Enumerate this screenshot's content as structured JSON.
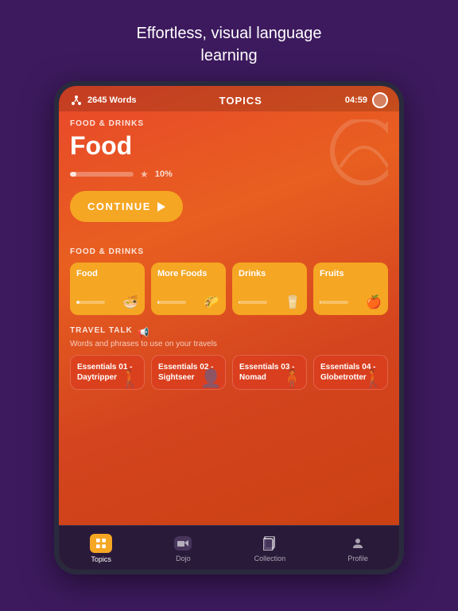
{
  "page": {
    "headline_line1": "Effortless, visual language",
    "headline_line2": "learning"
  },
  "status_bar": {
    "word_count": "2645 Words",
    "title": "TOPICS",
    "timer": "04:59"
  },
  "hero": {
    "category": "FOOD & DRINKS",
    "title": "Food",
    "progress_pct": "10%",
    "progress_value": 10,
    "continue_label": "CONTINUE"
  },
  "food_section": {
    "label": "FOOD & DRINKS",
    "cards": [
      {
        "title": "Food",
        "icon": "🍜",
        "progress": 10
      },
      {
        "title": "More Foods",
        "icon": "🌮",
        "progress": 5
      },
      {
        "title": "Drinks",
        "icon": "🥛",
        "progress": 3
      },
      {
        "title": "Fruits",
        "icon": "🍎",
        "progress": 2
      }
    ]
  },
  "travel_section": {
    "label": "TRAVEL TALK",
    "subtitle": "Words and phrases to use on your travels",
    "cards": [
      {
        "title": "Essentials 01 - Daytripper"
      },
      {
        "title": "Essentials 02 - Sightseer"
      },
      {
        "title": "Essentials 03 - Nomad"
      },
      {
        "title": "Essentials 04 - Globetrotter"
      }
    ]
  },
  "bottom_nav": {
    "items": [
      {
        "label": "Topics",
        "active": true
      },
      {
        "label": "Dojo",
        "active": false
      },
      {
        "label": "Collection",
        "active": false
      },
      {
        "label": "Profile",
        "active": false
      }
    ]
  }
}
